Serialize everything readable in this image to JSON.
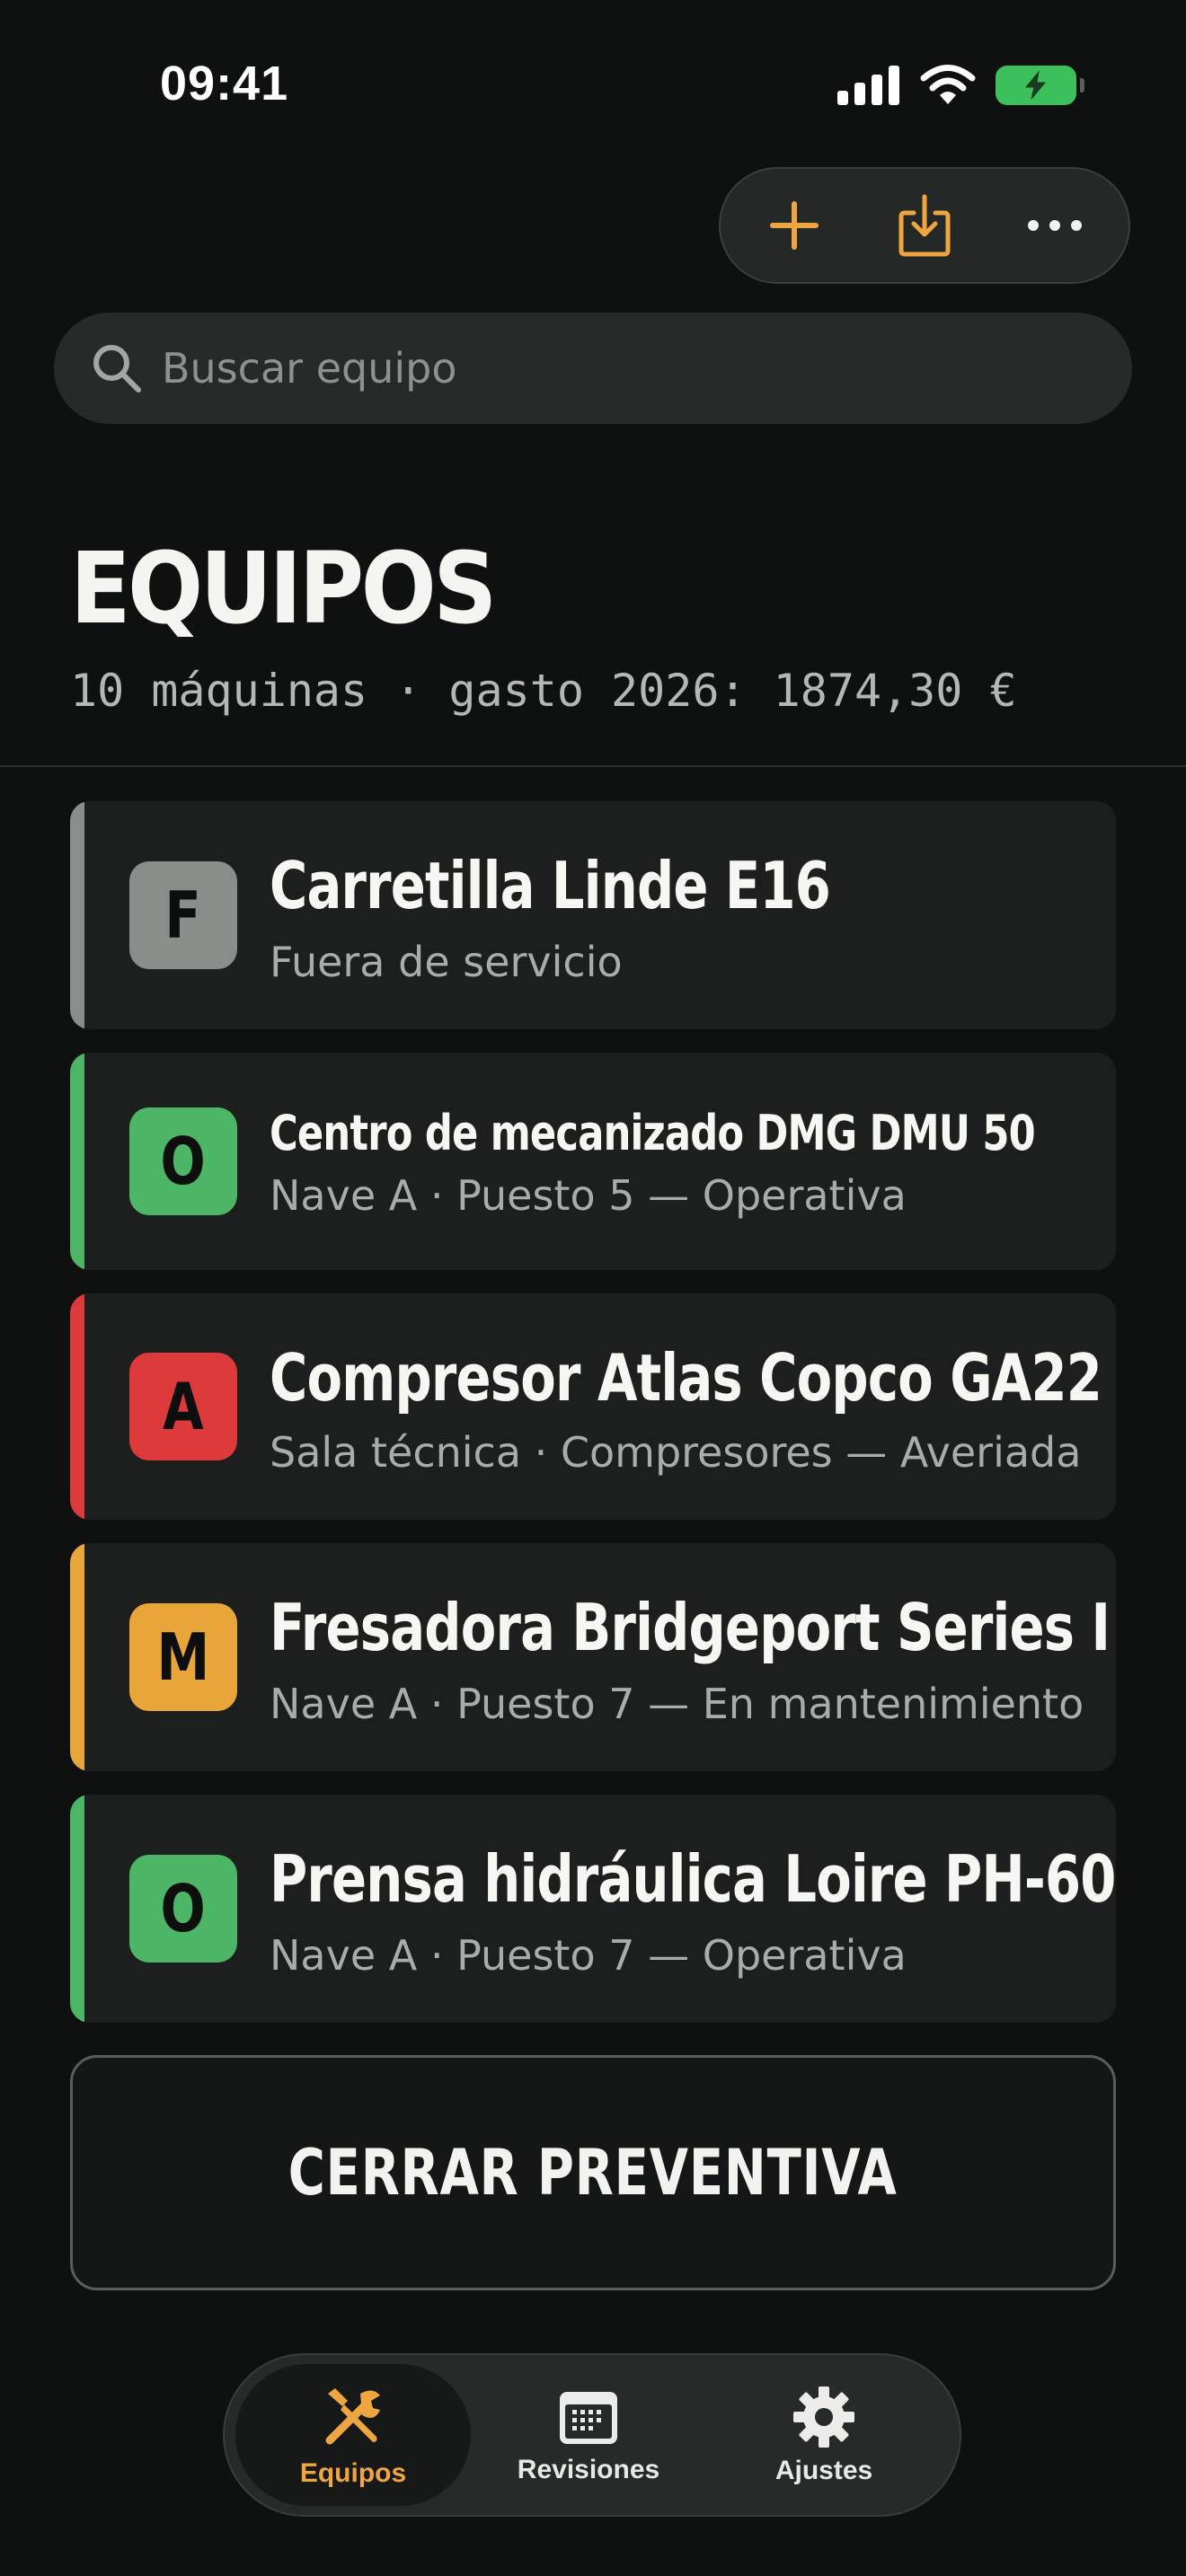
{
  "status_bar": {
    "time": "09:41"
  },
  "toolbar": {
    "add_icon": "plus-icon",
    "import_icon": "download-tray-icon",
    "more_icon": "ellipsis-icon"
  },
  "search": {
    "placeholder": "Buscar equipo",
    "value": ""
  },
  "header": {
    "title": "EQUIPOS",
    "subtitle": "10 máquinas · gasto 2026: 1874,30 €"
  },
  "colors": {
    "accent": "#f0a640",
    "status_out": "#8a8d8a",
    "status_operational": "#4db566",
    "status_broken": "#dd3b3b",
    "status_maintenance": "#e8a53a"
  },
  "equipment": [
    {
      "badge": "F",
      "name": "Carretilla Linde E16",
      "detail": "Fuera de servicio",
      "color": "#8a8d8a"
    },
    {
      "badge": "O",
      "name": "Centro de mecanizado DMG DMU 50",
      "detail": "Nave A · Puesto 5 — Operativa",
      "color": "#4db566"
    },
    {
      "badge": "A",
      "name": "Compresor Atlas Copco GA22",
      "detail": "Sala técnica · Compresores — Averiada",
      "color": "#dd3b3b"
    },
    {
      "badge": "M",
      "name": "Fresadora Bridgeport Series I",
      "detail": "Nave A · Puesto 7 — En mantenimiento",
      "color": "#e8a53a"
    },
    {
      "badge": "O",
      "name": "Prensa hidráulica Loire PH-60",
      "detail": "Nave A · Puesto 7 — Operativa",
      "color": "#4db566"
    }
  ],
  "actions": {
    "close_preventive": "CERRAR PREVENTIVA"
  },
  "tabbar": {
    "tabs": [
      {
        "label": "Equipos",
        "icon": "tools-icon",
        "active": true
      },
      {
        "label": "Revisiones",
        "icon": "calendar-icon",
        "active": false
      },
      {
        "label": "Ajustes",
        "icon": "gear-icon",
        "active": false
      }
    ]
  }
}
